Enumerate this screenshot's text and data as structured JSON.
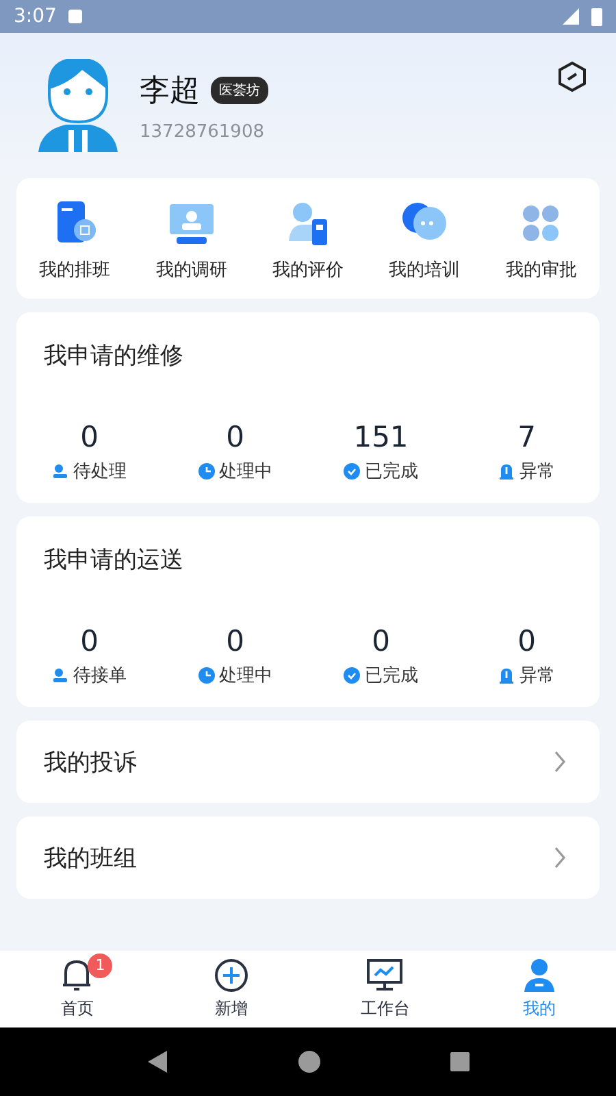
{
  "status_bar": {
    "time": "3:07"
  },
  "profile": {
    "name": "李超",
    "tag": "医荟坊",
    "phone": "13728761908"
  },
  "shortcuts": [
    {
      "label": "我的排班",
      "kind": "schedule"
    },
    {
      "label": "我的调研",
      "kind": "survey"
    },
    {
      "label": "我的评价",
      "kind": "review"
    },
    {
      "label": "我的培训",
      "kind": "training"
    },
    {
      "label": "我的审批",
      "kind": "approval"
    }
  ],
  "sections": [
    {
      "title": "我申请的维修",
      "stats": [
        {
          "value": "0",
          "label": "待处理",
          "kind": "pending"
        },
        {
          "value": "0",
          "label": "处理中",
          "kind": "processing"
        },
        {
          "value": "151",
          "label": "已完成",
          "kind": "done"
        },
        {
          "value": "7",
          "label": "异常",
          "kind": "error"
        }
      ]
    },
    {
      "title": "我申请的运送",
      "stats": [
        {
          "value": "0",
          "label": "待接单",
          "kind": "pending"
        },
        {
          "value": "0",
          "label": "处理中",
          "kind": "processing"
        },
        {
          "value": "0",
          "label": "已完成",
          "kind": "done"
        },
        {
          "value": "0",
          "label": "异常",
          "kind": "error"
        }
      ]
    }
  ],
  "links": [
    {
      "label": "我的投诉"
    },
    {
      "label": "我的班组"
    }
  ],
  "tab_bar": [
    {
      "label": "首页",
      "kind": "home",
      "badge": "1",
      "selected": false
    },
    {
      "label": "新增",
      "kind": "add",
      "selected": false
    },
    {
      "label": "工作台",
      "kind": "desk",
      "selected": false
    },
    {
      "label": "我的",
      "kind": "me",
      "selected": true
    }
  ]
}
